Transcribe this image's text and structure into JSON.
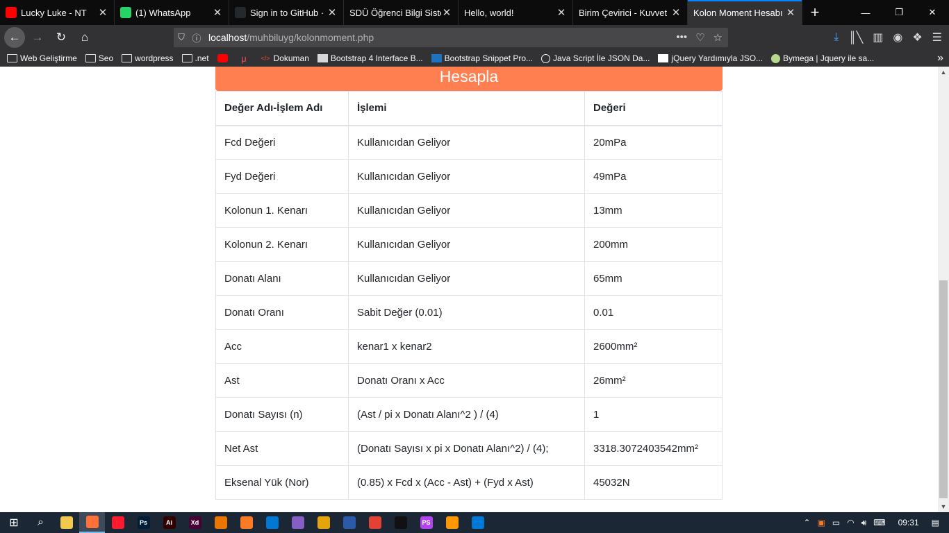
{
  "tabs": [
    {
      "title": "Lucky Luke - NT",
      "icon": "youtube-icon",
      "color": "#ff0000",
      "active": false
    },
    {
      "title": "(1) WhatsApp",
      "icon": "whatsapp-icon",
      "color": "#25d366",
      "active": false
    },
    {
      "title": "Sign in to GitHub · G",
      "icon": "github-icon",
      "color": "#24292e",
      "active": false
    },
    {
      "title": "SDÜ Öğrenci Bilgi Sisten",
      "icon": "",
      "color": "",
      "active": false
    },
    {
      "title": "Hello, world!",
      "icon": "",
      "color": "",
      "active": false
    },
    {
      "title": "Birim Çevirici - Kuvvet",
      "icon": "",
      "color": "",
      "active": false
    },
    {
      "title": "Kolon Moment Hesabı",
      "icon": "",
      "color": "",
      "active": true
    }
  ],
  "urlbar": {
    "host": "localhost",
    "path": "/muhbiluyg/kolonmoment.php"
  },
  "bookmarks": [
    {
      "label": "Web Geliştirme",
      "icon": "folder-icon"
    },
    {
      "label": "Seo",
      "icon": "folder-icon"
    },
    {
      "label": "wordpress",
      "icon": "folder-icon"
    },
    {
      "label": ".net",
      "icon": "folder-icon"
    },
    {
      "label": "",
      "icon": "youtube-icon"
    },
    {
      "label": "",
      "icon": "udemy-icon"
    },
    {
      "label": "Dokuman",
      "icon": "code-icon"
    },
    {
      "label": "Bootstrap 4 Interface B...",
      "icon": "cube-icon"
    },
    {
      "label": "Bootstrap Snippet Pro...",
      "icon": "bootstrap-icon"
    },
    {
      "label": "Java Script İle JSON Da...",
      "icon": "globe-icon"
    },
    {
      "label": "jQuery Yardımıyla JSO...",
      "icon": "medium-icon"
    },
    {
      "label": "Bymega | Jquery ile sa...",
      "icon": "avatar-icon"
    }
  ],
  "calculator": {
    "header": "Hesapla",
    "columns": [
      "Değer Adı-İşlem Adı",
      "İşlemi",
      "Değeri"
    ],
    "rows": [
      [
        "Fcd Değeri",
        "Kullanıcıdan Geliyor",
        "20mPa"
      ],
      [
        "Fyd Değeri",
        "Kullanıcıdan Geliyor",
        "49mPa"
      ],
      [
        "Kolonun 1. Kenarı",
        "Kullanıcıdan Geliyor",
        "13mm"
      ],
      [
        "Kolonun 2. Kenarı",
        "Kullanıcıdan Geliyor",
        "200mm"
      ],
      [
        "Donatı Alanı",
        "Kullanıcıdan Geliyor",
        "65mm"
      ],
      [
        "Donatı Oranı",
        "Sabit Değer (0.01)",
        "0.01"
      ],
      [
        "Acc",
        "kenar1 x kenar2",
        "2600mm²"
      ],
      [
        "Ast",
        "Donatı Oranı x Acc",
        "26mm²"
      ],
      [
        "Donatı Sayısı (n)",
        "(Ast / pi x Donatı Alanı^2 ) / (4)",
        "1"
      ],
      [
        "Net Ast",
        "(Donatı Sayısı x pi x Donatı Alanı^2) / (4);",
        "3318.3072403542mm²"
      ],
      [
        "Eksenal Yük (Nor)",
        "(0.85) x Fcd x (Acc - Ast) + (Fyd x Ast)",
        "45032N"
      ]
    ]
  },
  "taskbar": {
    "time": "09:31",
    "apps": [
      {
        "name": "file-explorer-icon",
        "label": "",
        "color": "#f2c94c"
      },
      {
        "name": "firefox-icon",
        "label": "",
        "color": "#ff7139"
      },
      {
        "name": "opera-icon",
        "label": "",
        "color": "#ff1b2d"
      },
      {
        "name": "photoshop-icon",
        "label": "Ps",
        "color": "#001e36"
      },
      {
        "name": "illustrator-icon",
        "label": "Ai",
        "color": "#330000"
      },
      {
        "name": "xd-icon",
        "label": "Xd",
        "color": "#470137"
      },
      {
        "name": "blender-icon",
        "label": "",
        "color": "#ea7600"
      },
      {
        "name": "xampp-icon",
        "label": "",
        "color": "#fb7a24"
      },
      {
        "name": "vscode-icon",
        "label": "",
        "color": "#0078d4"
      },
      {
        "name": "visual-studio-icon",
        "label": "",
        "color": "#865fc5"
      },
      {
        "name": "app-icon",
        "label": "",
        "color": "#e5a50a"
      },
      {
        "name": "powershell-icon",
        "label": "",
        "color": "#2a5aa8"
      },
      {
        "name": "chrome-icon",
        "label": "",
        "color": "#e34133"
      },
      {
        "name": "cmd-icon",
        "label": "",
        "color": "#111111"
      },
      {
        "name": "phpstorm-icon",
        "label": "PS",
        "color": "#b345f1"
      },
      {
        "name": "sublime-icon",
        "label": "",
        "color": "#ff9800"
      },
      {
        "name": "edge-icon",
        "label": "",
        "color": "#0078d7"
      }
    ]
  }
}
